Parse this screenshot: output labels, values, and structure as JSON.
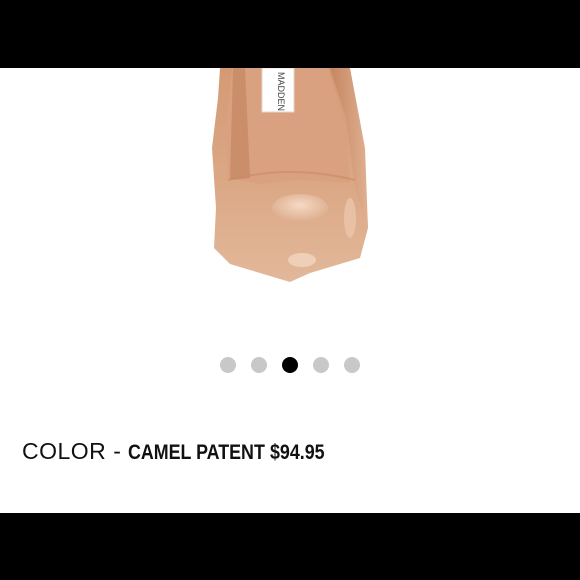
{
  "product": {
    "image_alt": "Camel patent pointed-toe pump",
    "brand_tag": "MADDEN",
    "color_label": "COLOR",
    "color_separator": "-",
    "color_value": "CAMEL PATENT",
    "price": "$94.95",
    "shoe_color": "#d9a684"
  },
  "carousel": {
    "count": 5,
    "active_index": 2,
    "active_color": "#000000",
    "inactive_color": "#c8c8c8"
  }
}
